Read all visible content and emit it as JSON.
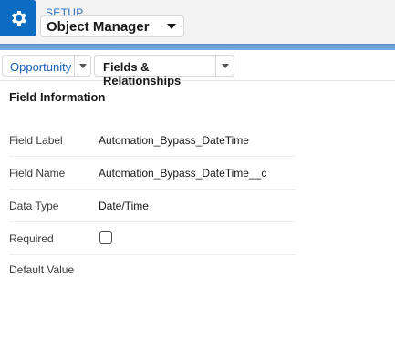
{
  "header": {
    "setup_label": "SETUP",
    "object_manager_label": "Object Manager",
    "icon": "gear-icon",
    "accent_color": "#0b6cc1"
  },
  "tabs": {
    "object_label": "Opportunity",
    "section_label": "Fields & Relationships"
  },
  "field_info": {
    "title": "Field Information",
    "rows": [
      {
        "label": "Field Label",
        "value": "Automation_Bypass_DateTime"
      },
      {
        "label": "Field Name",
        "value": "Automation_Bypass_DateTime__c"
      },
      {
        "label": "Data Type",
        "value": "Date/Time"
      },
      {
        "label": "Required",
        "value": null,
        "checked": false
      },
      {
        "label": "Default Value",
        "value": ""
      }
    ]
  }
}
